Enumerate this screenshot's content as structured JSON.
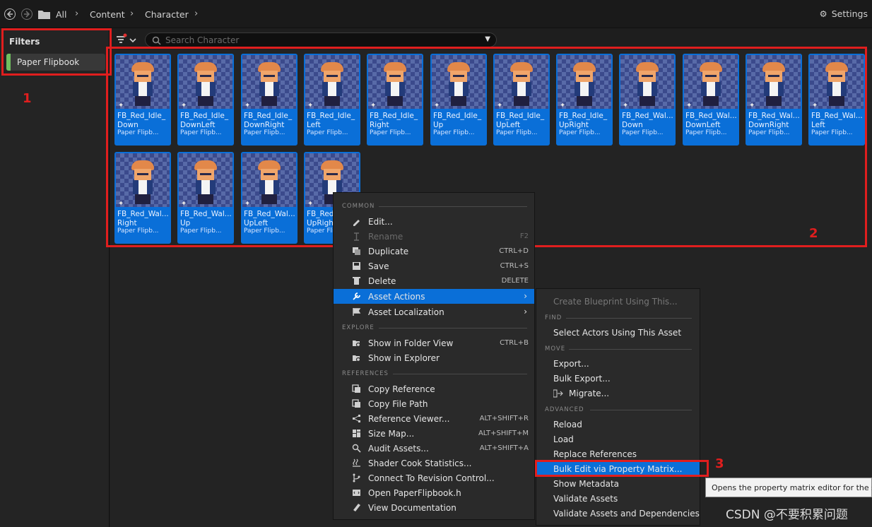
{
  "topbar": {
    "breadcrumb": [
      "All",
      "Content",
      "Character"
    ],
    "settings_label": "Settings"
  },
  "filters": {
    "title": "Filters",
    "items": [
      {
        "label": "Paper Flipbook",
        "color": "#6fbf5f"
      }
    ]
  },
  "search": {
    "placeholder": "Search Character"
  },
  "assets": [
    {
      "line1": "FB_Red_Idle_",
      "line2": "Down",
      "type": "Paper Flipb..."
    },
    {
      "line1": "FB_Red_Idle_",
      "line2": "DownLeft",
      "type": "Paper Flipb..."
    },
    {
      "line1": "FB_Red_Idle_",
      "line2": "DownRight",
      "type": "Paper Flipb..."
    },
    {
      "line1": "FB_Red_Idle_",
      "line2": "Left",
      "type": "Paper Flipb..."
    },
    {
      "line1": "FB_Red_Idle_",
      "line2": "Right",
      "type": "Paper Flipb..."
    },
    {
      "line1": "FB_Red_Idle_",
      "line2": "Up",
      "type": "Paper Flipb..."
    },
    {
      "line1": "FB_Red_Idle_",
      "line2": "UpLeft",
      "type": "Paper Flipb..."
    },
    {
      "line1": "FB_Red_Idle_",
      "line2": "UpRight",
      "type": "Paper Flipb..."
    },
    {
      "line1": "FB_Red_Wal...",
      "line2": "Down",
      "type": "Paper Flipb..."
    },
    {
      "line1": "FB_Red_Wal...",
      "line2": "DownLeft",
      "type": "Paper Flipb..."
    },
    {
      "line1": "FB_Red_Wal...",
      "line2": "DownRight",
      "type": "Paper Flipb..."
    },
    {
      "line1": "FB_Red_Wal...",
      "line2": "Left",
      "type": "Paper Flipb..."
    },
    {
      "line1": "FB_Red_Wal...",
      "line2": "Right",
      "type": "Paper Flipb..."
    },
    {
      "line1": "FB_Red_Wal...",
      "line2": "Up",
      "type": "Paper Flipb..."
    },
    {
      "line1": "FB_Red_Wal...",
      "line2": "UpLeft",
      "type": "Paper Flipb..."
    },
    {
      "line1": "FB_Red_Wal...",
      "line2": "UpRight",
      "type": "Paper Flip..."
    }
  ],
  "context_menu": {
    "sections": {
      "common": "COMMON",
      "explore": "EXPLORE",
      "references": "REFERENCES"
    },
    "items": [
      {
        "label": "Edit...",
        "shortcut": "",
        "icon": "pencil-icon"
      },
      {
        "label": "Rename",
        "shortcut": "F2",
        "icon": "rename-icon",
        "disabled": true
      },
      {
        "label": "Duplicate",
        "shortcut": "CTRL+D",
        "icon": "duplicate-icon"
      },
      {
        "label": "Save",
        "shortcut": "CTRL+S",
        "icon": "save-icon"
      },
      {
        "label": "Delete",
        "shortcut": "DELETE",
        "icon": "trash-icon"
      },
      {
        "label": "Asset Actions",
        "shortcut": "",
        "icon": "wrench-icon",
        "active": true,
        "submenu": true
      },
      {
        "label": "Asset Localization",
        "shortcut": "",
        "icon": "flag-icon",
        "submenu": true
      },
      {
        "label": "Show in Folder View",
        "shortcut": "CTRL+B",
        "icon": "folder-search-icon"
      },
      {
        "label": "Show in Explorer",
        "shortcut": "",
        "icon": "folder-search-icon"
      },
      {
        "label": "Copy Reference",
        "shortcut": "",
        "icon": "copy-icon"
      },
      {
        "label": "Copy File Path",
        "shortcut": "",
        "icon": "copy-icon"
      },
      {
        "label": "Reference Viewer...",
        "shortcut": "ALT+SHIFT+R",
        "icon": "graph-icon"
      },
      {
        "label": "Size Map...",
        "shortcut": "ALT+SHIFT+M",
        "icon": "grid-icon"
      },
      {
        "label": "Audit Assets...",
        "shortcut": "ALT+SHIFT+A",
        "icon": "audit-icon"
      },
      {
        "label": "Shader Cook Statistics...",
        "shortcut": "",
        "icon": "steam-icon"
      },
      {
        "label": "Connect To Revision Control...",
        "shortcut": "",
        "icon": "branch-icon"
      },
      {
        "label": "Open PaperFlipbook.h",
        "shortcut": "",
        "icon": "code-icon"
      },
      {
        "label": "View Documentation",
        "shortcut": "",
        "icon": "book-icon"
      }
    ]
  },
  "submenu": {
    "sections": {
      "find": "FIND",
      "move": "MOVE",
      "advanced": "ADVANCED"
    },
    "items": [
      {
        "label": "Create Blueprint Using This...",
        "disabled": true
      },
      {
        "label": "Select Actors Using This Asset"
      },
      {
        "label": "Export..."
      },
      {
        "label": "Bulk Export..."
      },
      {
        "label": "Migrate..."
      },
      {
        "label": "Reload"
      },
      {
        "label": "Load"
      },
      {
        "label": "Replace References"
      },
      {
        "label": "Bulk Edit via Property Matrix...",
        "active": true
      },
      {
        "label": "Show Metadata"
      },
      {
        "label": "Validate Assets"
      },
      {
        "label": "Validate Assets and Dependencies"
      }
    ]
  },
  "tooltip": "Opens the property matrix editor for the se",
  "annotations": [
    "1",
    "2",
    "3"
  ],
  "watermark": "CSDN @不要积累问题"
}
